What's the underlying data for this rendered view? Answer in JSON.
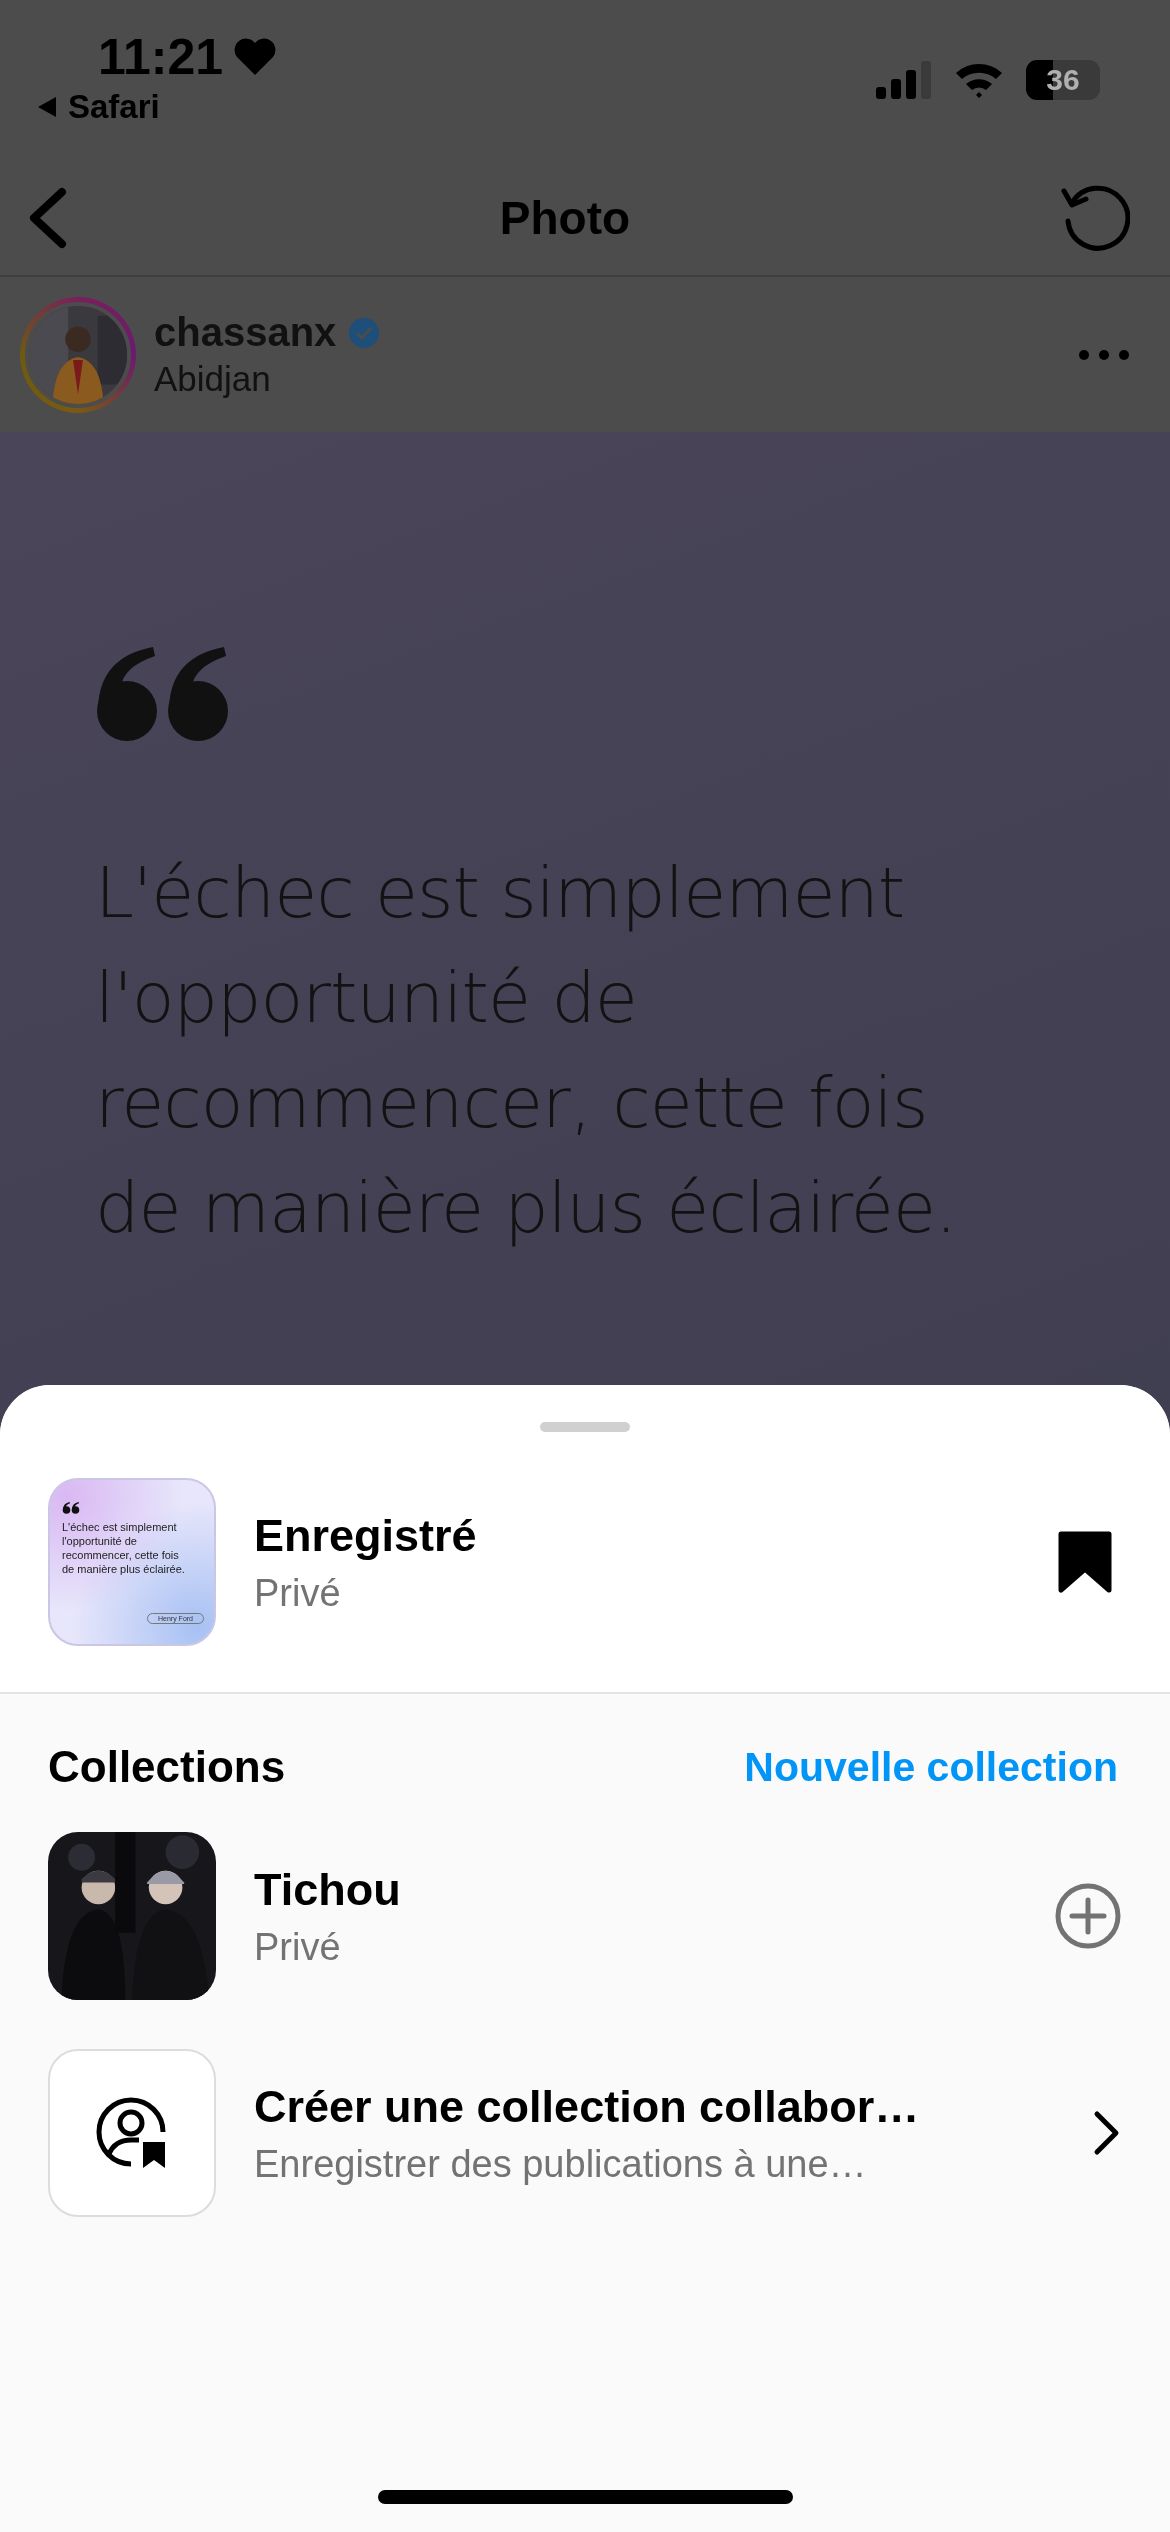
{
  "status_bar": {
    "time": "11:21",
    "back_app": "Safari",
    "battery": "36"
  },
  "nav": {
    "title": "Photo"
  },
  "post": {
    "username": "chassanx",
    "verified": true,
    "location": "Abidjan",
    "quote_lines": [
      "L'échec est simplement",
      "l'opportunité de",
      "recommencer, cette fois",
      "de manière plus éclairée."
    ]
  },
  "sheet": {
    "saved": {
      "title": "Enregistré",
      "subtitle": "Privé",
      "saved": true,
      "thumbnail": {
        "quote_lines": [
          "L'échec est simplement",
          "l'opportunité de",
          "recommencer, cette fois",
          "de manière plus éclairée."
        ],
        "author": "Henry Ford"
      }
    },
    "collections_heading": "Collections",
    "new_collection": "Nouvelle collection",
    "collections": [
      {
        "kind": "collection",
        "title": "Tichou",
        "subtitle": "Privé"
      },
      {
        "kind": "create",
        "title": "Créer une collection collabor…",
        "subtitle": "Enregistrer des publications à une…"
      }
    ]
  }
}
